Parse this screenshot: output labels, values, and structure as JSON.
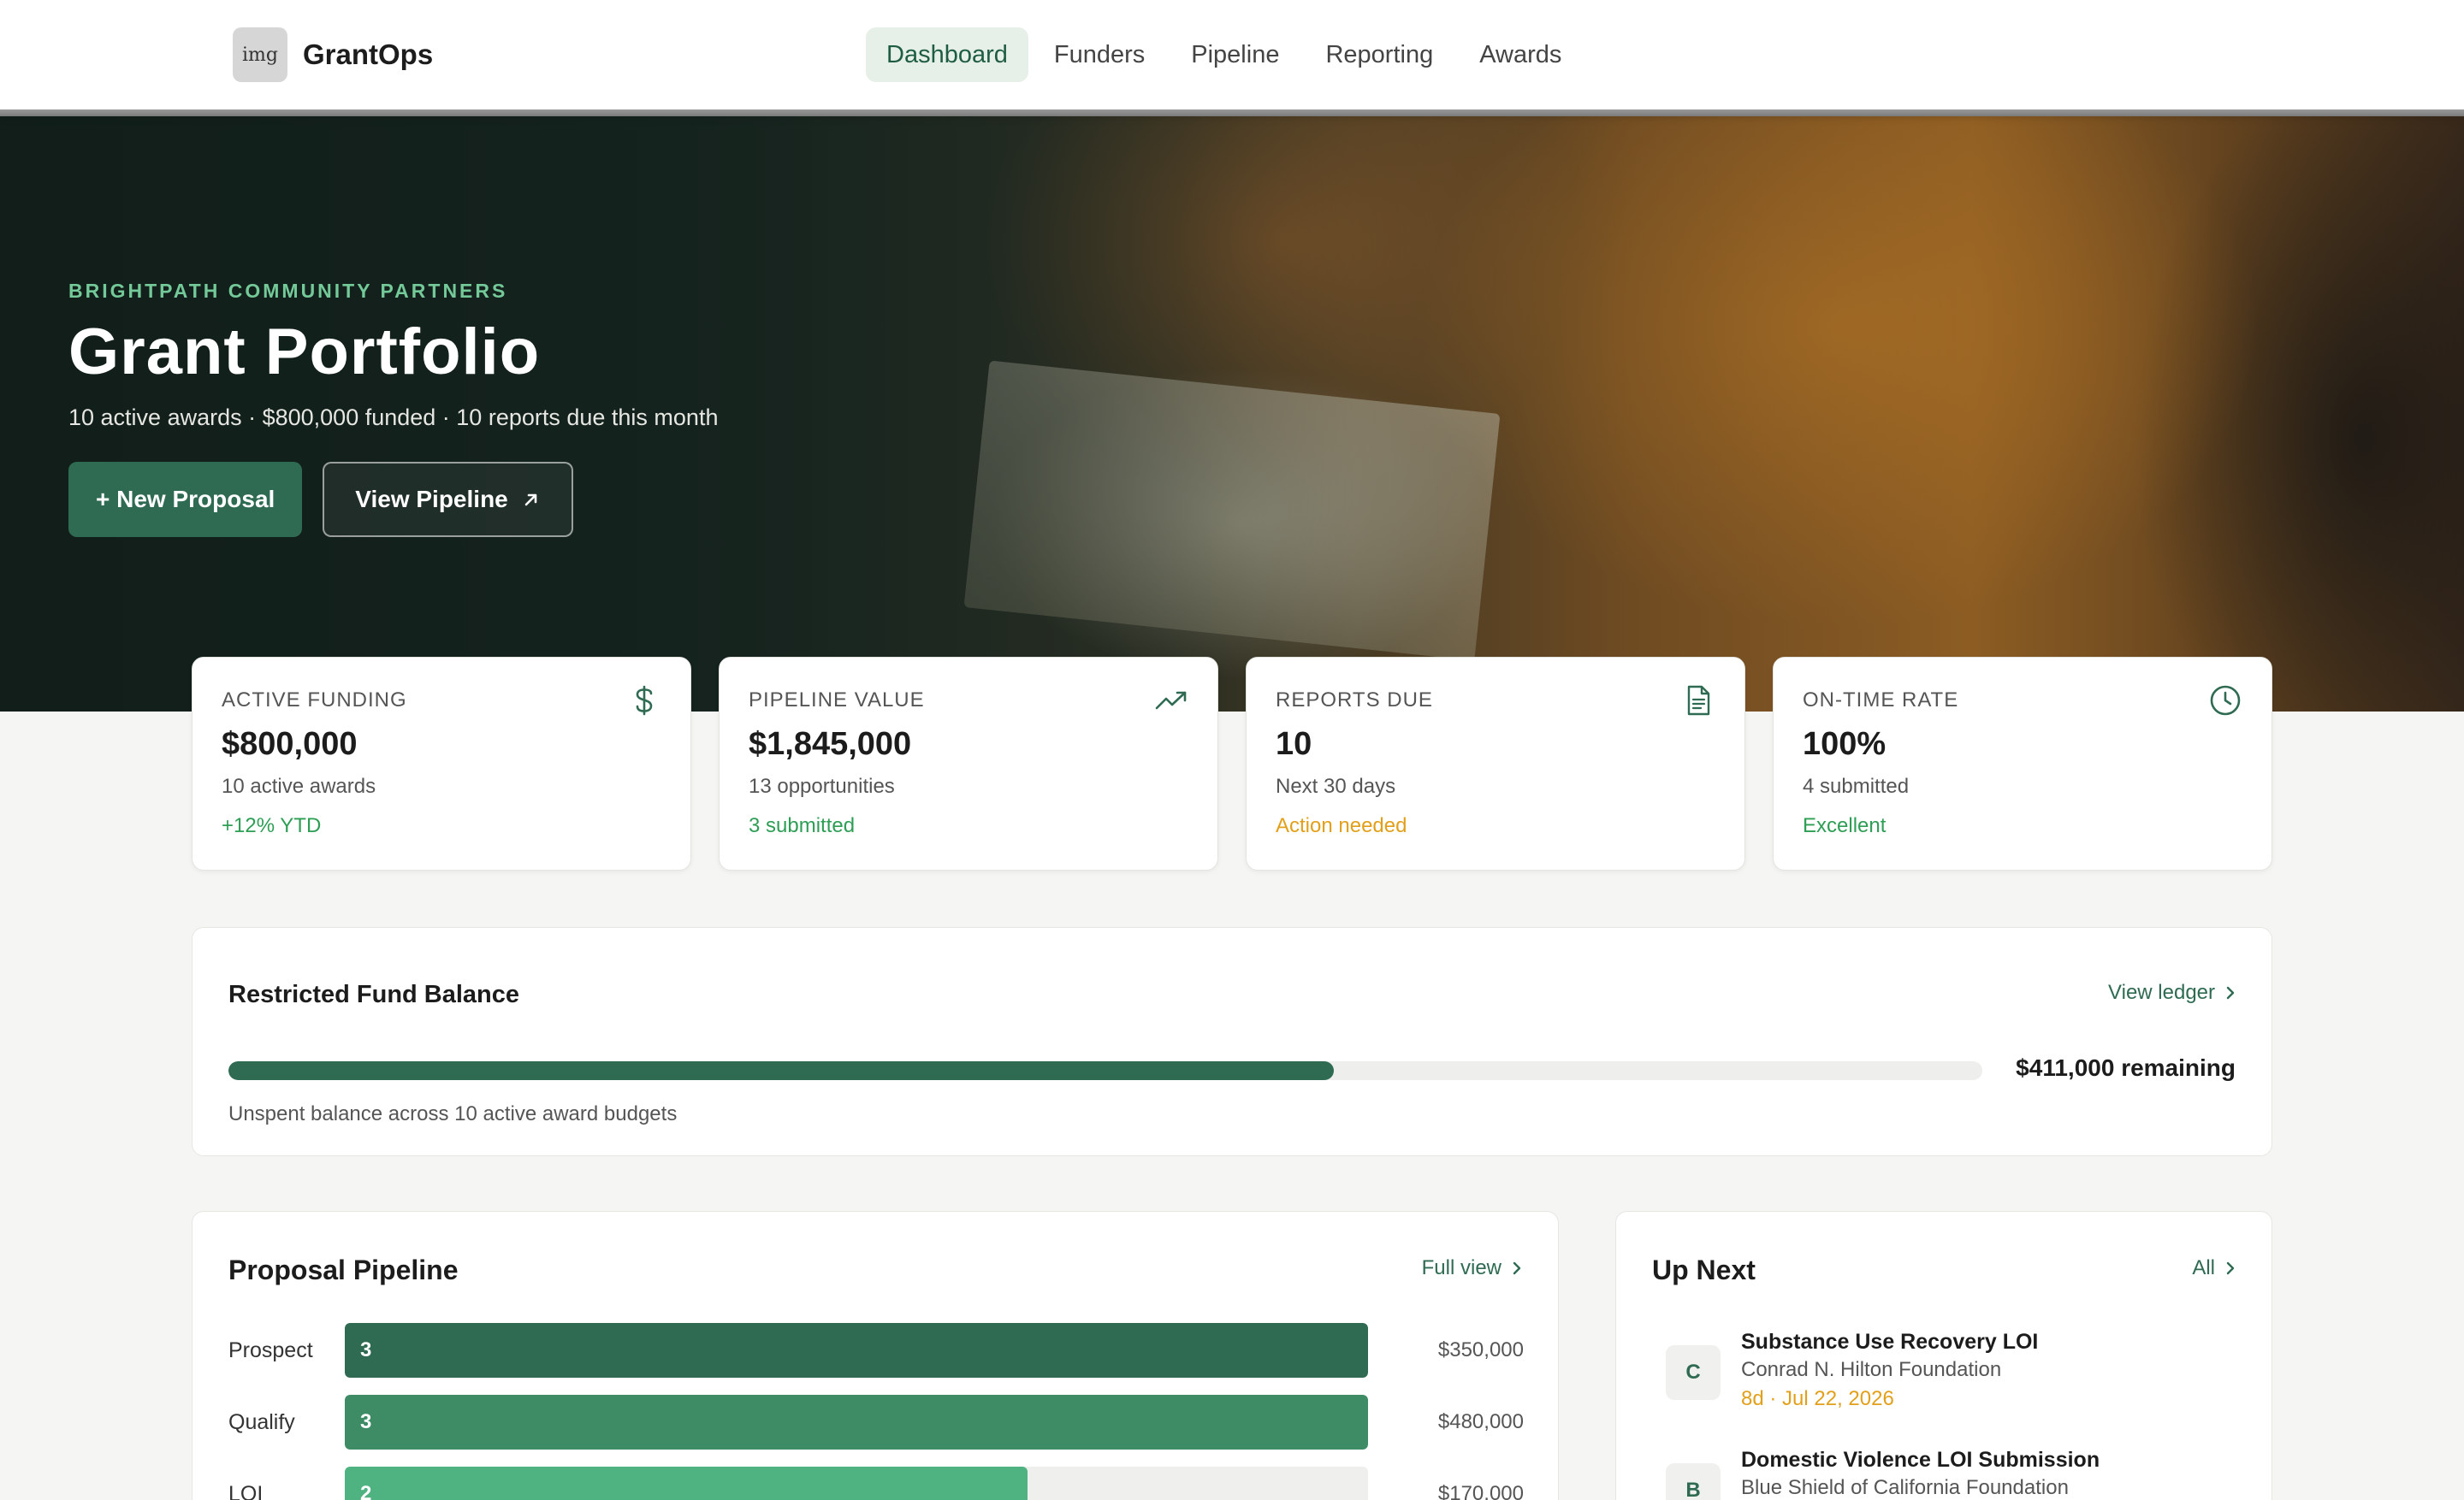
{
  "nav": {
    "logo_text": "img",
    "brand": "GrantOps",
    "links": [
      {
        "label": "Dashboard",
        "active": true
      },
      {
        "label": "Funders",
        "active": false
      },
      {
        "label": "Pipeline",
        "active": false
      },
      {
        "label": "Reporting",
        "active": false
      },
      {
        "label": "Awards",
        "active": false
      }
    ]
  },
  "hero": {
    "eyebrow": "BRIGHTPATH COMMUNITY PARTNERS",
    "title": "Grant Portfolio",
    "subtitle": "10 active awards · $800,000 funded · 10 reports due this month",
    "primary_button": "+ New Proposal",
    "secondary_button": "View Pipeline"
  },
  "stats": [
    {
      "label": "ACTIVE FUNDING",
      "value": "$800,000",
      "sub": "10 active awards",
      "note": "+12% YTD",
      "note_tone": "green",
      "icon": "dollar-icon"
    },
    {
      "label": "PIPELINE VALUE",
      "value": "$1,845,000",
      "sub": "13 opportunities",
      "note": "3 submitted",
      "note_tone": "green",
      "icon": "trending-up-icon"
    },
    {
      "label": "REPORTS DUE",
      "value": "10",
      "sub": "Next 30 days",
      "note": "Action needed",
      "note_tone": "amber",
      "icon": "document-icon"
    },
    {
      "label": "ON-TIME RATE",
      "value": "100%",
      "sub": "4 submitted",
      "note": "Excellent",
      "note_tone": "green",
      "icon": "clock-icon"
    }
  ],
  "fund_balance": {
    "title": "Restricted Fund Balance",
    "link": "View ledger",
    "spent_fraction": 0.63,
    "remaining": "$411,000 remaining",
    "caption": "Unspent balance across 10 active award budgets"
  },
  "pipeline": {
    "title": "Proposal Pipeline",
    "link": "Full view",
    "stages": [
      {
        "label": "Prospect",
        "count": "3",
        "fraction": 1.0,
        "amount": "$350,000",
        "color": "#2e6b52"
      },
      {
        "label": "Qualify",
        "count": "3",
        "fraction": 1.0,
        "amount": "$480,000",
        "color": "#3d8c66"
      },
      {
        "label": "LOI",
        "count": "2",
        "fraction": 0.667,
        "amount": "$170,000",
        "color": "#4fb381"
      }
    ]
  },
  "up_next": {
    "title": "Up Next",
    "link": "All",
    "items": [
      {
        "badge": "C",
        "name": "Substance Use Recovery LOI",
        "funder": "Conrad N. Hilton Foundation",
        "due": "8d · Jul 22, 2026"
      },
      {
        "badge": "B",
        "name": "Domestic Violence LOI Submission",
        "funder": "Blue Shield of California Foundation",
        "due": ""
      }
    ]
  },
  "colors": {
    "accent": "#2e6b52",
    "positive": "#2e9e55",
    "warning": "#e2a01a"
  }
}
